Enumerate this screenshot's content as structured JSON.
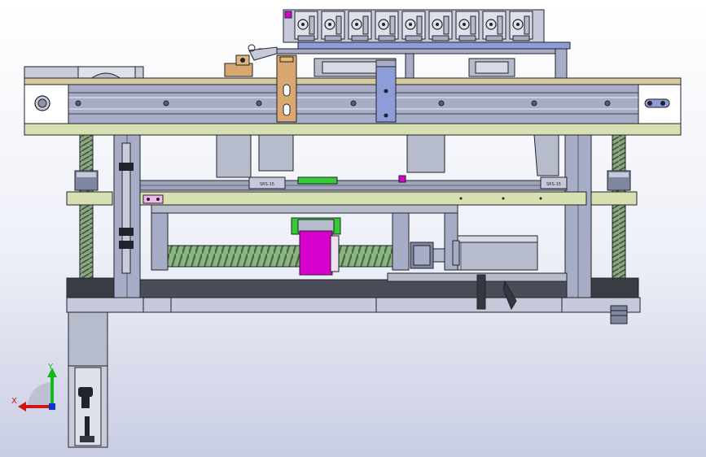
{
  "view": {
    "type": "cad-assembly-front-view",
    "background": {
      "top": "#ffffff",
      "bottom": "#c9cde3"
    }
  },
  "triad": {
    "x_label": "X",
    "y_label": "Y",
    "x_color": "#d01515",
    "y_color": "#15b815",
    "z_color": "#1530d0"
  },
  "rail_labels": {
    "left_block": "SRS-15",
    "right_block": "SRS-15"
  },
  "colors": {
    "steel": "#a7adc6",
    "steel_dark": "#7f869f",
    "wood": "#d8caa0",
    "frame_green": "#d6e0b0",
    "guide_blue": "#8e9cd8",
    "nut_magenta": "#d800cc",
    "nut_green": "#33cc33",
    "bracket_orange": "#d8a870",
    "screw_green": "#7aa070",
    "motor": "#b7bccd",
    "outline": "#20222c"
  },
  "components": {
    "gripper_count": 9,
    "ball_screw": "horizontal",
    "lead_screws": "vertical-2"
  }
}
